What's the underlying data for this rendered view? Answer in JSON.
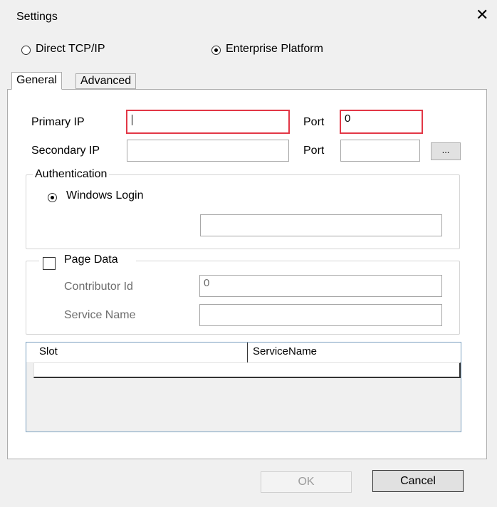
{
  "window": {
    "title": "Settings",
    "close_glyph": "✕"
  },
  "connection_mode": {
    "options": [
      {
        "label": "Direct TCP/IP",
        "selected": false
      },
      {
        "label": "Enterprise Platform",
        "selected": true
      }
    ]
  },
  "tabs": [
    {
      "label": "General",
      "active": true
    },
    {
      "label": "Advanced",
      "active": false
    }
  ],
  "general": {
    "primary_ip": {
      "label": "Primary IP",
      "value": ""
    },
    "primary_port": {
      "label": "Port",
      "value": "0"
    },
    "secondary_ip": {
      "label": "Secondary IP",
      "value": ""
    },
    "secondary_port": {
      "label": "Port",
      "value": ""
    },
    "browse_button": "...",
    "authentication": {
      "title": "Authentication",
      "windows_login": {
        "label": "Windows Login",
        "selected": true
      },
      "login_field": ""
    },
    "page_data": {
      "title": "Page Data",
      "checked": false,
      "contributor_id": {
        "label": "Contributor Id",
        "value": "0"
      },
      "service_name": {
        "label": "Service Name",
        "value": ""
      }
    },
    "grid": {
      "columns": [
        "Slot",
        "ServiceName"
      ],
      "rows": [
        [
          "",
          ""
        ]
      ]
    }
  },
  "footer": {
    "ok_label": "OK",
    "cancel_label": "Cancel"
  },
  "colors": {
    "error_border": "#e23746",
    "grid_border": "#7a9fbf",
    "background": "#f0f0f0"
  }
}
